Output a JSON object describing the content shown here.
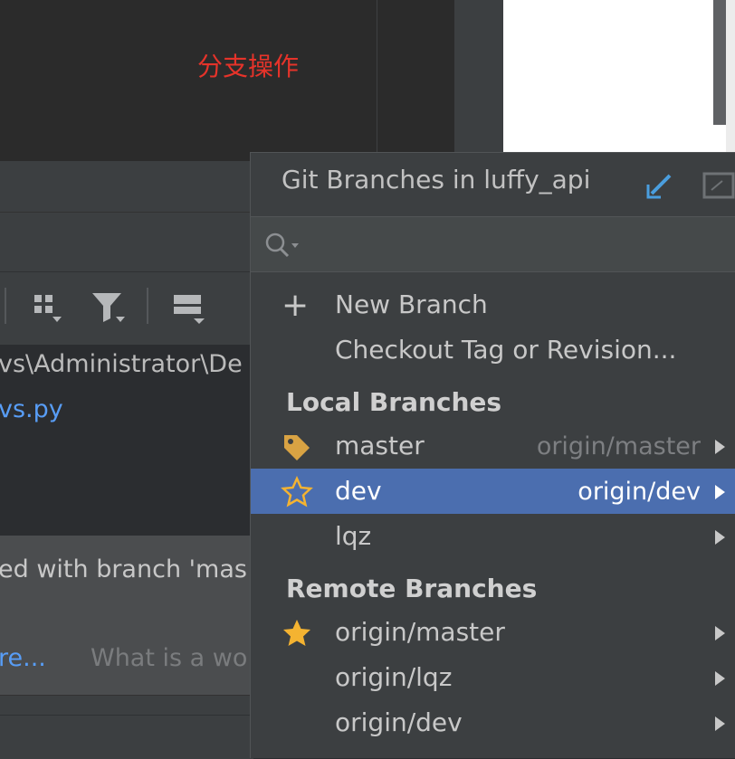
{
  "annotation": {
    "text": "分支操作",
    "color": "#e6332a"
  },
  "background": {
    "path_text": "vs\\Administrator\\De",
    "file_link": "vs.py",
    "notification_text": "ed with branch 'mas",
    "notification_link": "re...",
    "notification_grey": "What is a wo"
  },
  "popup": {
    "title": "Git Branches in luffy_api",
    "search_placeholder": "",
    "actions": [
      {
        "label": "New Branch",
        "icon": "plus-icon"
      },
      {
        "label": "Checkout Tag or Revision..."
      }
    ],
    "local_section": "Local Branches",
    "local_branches": [
      {
        "name": "master",
        "remote": "origin/master",
        "icon": "tag-icon"
      },
      {
        "name": "dev",
        "remote": "origin/dev",
        "icon": "star-outline-icon",
        "selected": true
      },
      {
        "name": "lqz",
        "remote": ""
      }
    ],
    "remote_section": "Remote Branches",
    "remote_branches": [
      {
        "name": "origin/master",
        "icon": "star-filled-icon"
      },
      {
        "name": "origin/lqz"
      },
      {
        "name": "origin/dev"
      }
    ]
  },
  "colors": {
    "accent_selected": "#4b6eaf",
    "link": "#589df6",
    "tag": "#d9a343",
    "star": "#f4b331",
    "edit_icon": "#4a9ede"
  }
}
